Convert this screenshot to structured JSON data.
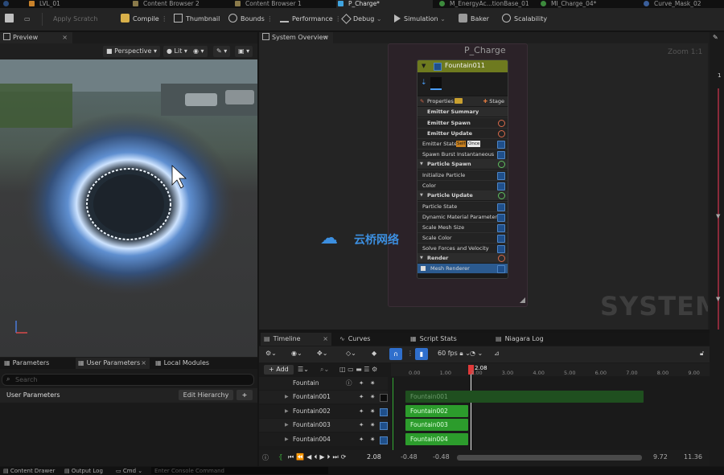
{
  "tabs": [
    {
      "label": "LVL_01",
      "active": false
    },
    {
      "label": "Content Browser 2",
      "active": false
    },
    {
      "label": "Content Browser 1",
      "active": false
    },
    {
      "label": "P_Charge*",
      "active": true
    },
    {
      "label": "M_EnergyAc...tionBase_01",
      "active": false
    },
    {
      "label": "MI_Charge_04*",
      "active": false
    },
    {
      "label": "Curve_Mask_02",
      "active": false
    }
  ],
  "toolbar": {
    "apply_scratch": "Apply Scratch",
    "compile": "Compile",
    "thumbnail": "Thumbnail",
    "bounds": "Bounds",
    "performance": "Performance",
    "debug": "Debug",
    "simulation": "Simulation",
    "baker": "Baker",
    "scalability": "Scalability"
  },
  "preview": {
    "tab": "Preview",
    "perspective": "Perspective",
    "lit": "Lit"
  },
  "system_overview": {
    "tab": "System Overview",
    "title": "P_Charge",
    "zoom": "Zoom 1:1",
    "watermark": "SYSTEM"
  },
  "node": {
    "name": "Fountain011",
    "properties": "Properties",
    "stage": "Stage",
    "rows": [
      {
        "label": "Emitter Summary",
        "kind": "hdr-plain"
      },
      {
        "label": "Emitter Spawn",
        "kind": "section"
      },
      {
        "label": "Emitter Update",
        "kind": "section"
      },
      {
        "label": "Emitter State",
        "kind": "state"
      },
      {
        "label": "Spawn Burst Instantaneous",
        "kind": "item"
      },
      {
        "label": "Particle Spawn",
        "kind": "group"
      },
      {
        "label": "Initialize Particle",
        "kind": "item"
      },
      {
        "label": "Color",
        "kind": "item"
      },
      {
        "label": "Particle Update",
        "kind": "group"
      },
      {
        "label": "Particle State",
        "kind": "item"
      },
      {
        "label": "Dynamic Material Parameters",
        "kind": "item"
      },
      {
        "label": "Scale Mesh Size",
        "kind": "item"
      },
      {
        "label": "Scale Color",
        "kind": "item"
      },
      {
        "label": "Solve Forces and Velocity",
        "kind": "item"
      },
      {
        "label": "Render",
        "kind": "render"
      },
      {
        "label": "Mesh Renderer",
        "kind": "selected"
      }
    ],
    "state_self": "Self",
    "state_once": "Once"
  },
  "logo_text": "云桥网络",
  "lower_left": {
    "tabs": [
      "Parameters",
      "User Parameters",
      "Local Modules"
    ],
    "search_placeholder": "Search",
    "section": "User Parameters",
    "edit_hierarchy": "Edit Hierarchy",
    "add": "+"
  },
  "timeline": {
    "tabs": [
      "Timeline",
      "Curves",
      "Script Stats",
      "Niagara Log"
    ],
    "fps": "60 fps",
    "add": "+ Add",
    "header_row": "Fountain",
    "tracks": [
      {
        "name": "Fountain001",
        "bar": "Fountain001",
        "enabled": false
      },
      {
        "name": "Fountain002",
        "bar": "Fountain002",
        "enabled": true
      },
      {
        "name": "Fountain003",
        "bar": "Fountain003",
        "enabled": true
      },
      {
        "name": "Fountain004",
        "bar": "Fountain004",
        "enabled": true
      }
    ],
    "ticks": [
      "0.00",
      "1.00",
      "2.00",
      "3.00",
      "4.00",
      "5.00",
      "6.00",
      "7.00",
      "8.00",
      "9.00"
    ],
    "playhead": "2.08",
    "current_time": "2.08",
    "range_start_a": "-0.48",
    "range_start_b": "-0.48",
    "range_end_a": "9.72",
    "range_end_b": "11.36"
  },
  "status": {
    "content_drawer": "Content Drawer",
    "output_log": "Output Log",
    "cmd": "Cmd",
    "console_placeholder": "Enter Console Command"
  },
  "colors": {
    "accent": "#4a9cf5",
    "node_header": "#6e7a1f",
    "track_green": "#2c9c2c",
    "playhead": "#e03a3a"
  }
}
